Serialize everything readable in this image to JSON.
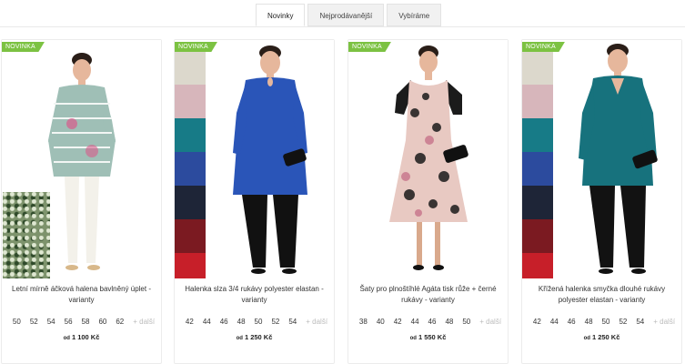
{
  "tabs": [
    {
      "label": "Novinky",
      "active": true
    },
    {
      "label": "Nejprodávanější",
      "active": false
    },
    {
      "label": "Vybíráme",
      "active": false
    }
  ],
  "products": [
    {
      "badge": "NOVINKA",
      "name": "Letní mírně áčková halena bavlněný úplet - varianty",
      "sizes": [
        "50",
        "52",
        "54",
        "56",
        "58",
        "60",
        "62"
      ],
      "more": "+ další",
      "price_prefix": "od",
      "price": "1 100 Kč",
      "colors": {
        "top": "#9fbfb6",
        "bottom": "#f3f1ea"
      }
    },
    {
      "badge": "NOVINKA",
      "name": "Halenka slza 3/4 rukávy polyester elastan - varianty",
      "sizes": [
        "42",
        "44",
        "46",
        "48",
        "50",
        "52",
        "54"
      ],
      "more": "+ další",
      "price_prefix": "od",
      "price": "1 250 Kč",
      "colors": {
        "top": "#2a55b8",
        "bottom": "#111111"
      },
      "swatches": [
        "#dcd8cc",
        "#d7b6bb",
        "#177b87",
        "#2c4b9e",
        "#1e2537",
        "#7b1a21",
        "#c71f29"
      ]
    },
    {
      "badge": "NOVINKA",
      "name": "Šaty pro plnoštíhlé Agáta tisk růže + černé rukávy - varianty",
      "sizes": [
        "38",
        "40",
        "42",
        "44",
        "46",
        "48",
        "50"
      ],
      "more": "+ další",
      "price_prefix": "od",
      "price": "1 550 Kč",
      "colors": {
        "top": "#1b1b1b",
        "bottom": "#e8c9c2"
      }
    },
    {
      "badge": "NOVINKA",
      "name": "Křížená halenka smyčka dlouhé rukávy polyester elastan - varianty",
      "sizes": [
        "42",
        "44",
        "46",
        "48",
        "50",
        "52",
        "54"
      ],
      "more": "+ další",
      "price_prefix": "od",
      "price": "1 250 Kč",
      "colors": {
        "top": "#17727d",
        "bottom": "#121212"
      },
      "swatches": [
        "#dcd8cc",
        "#d7b6bb",
        "#177b87",
        "#2c4b9e",
        "#1e2537",
        "#7b1a21",
        "#c71f29"
      ]
    }
  ]
}
